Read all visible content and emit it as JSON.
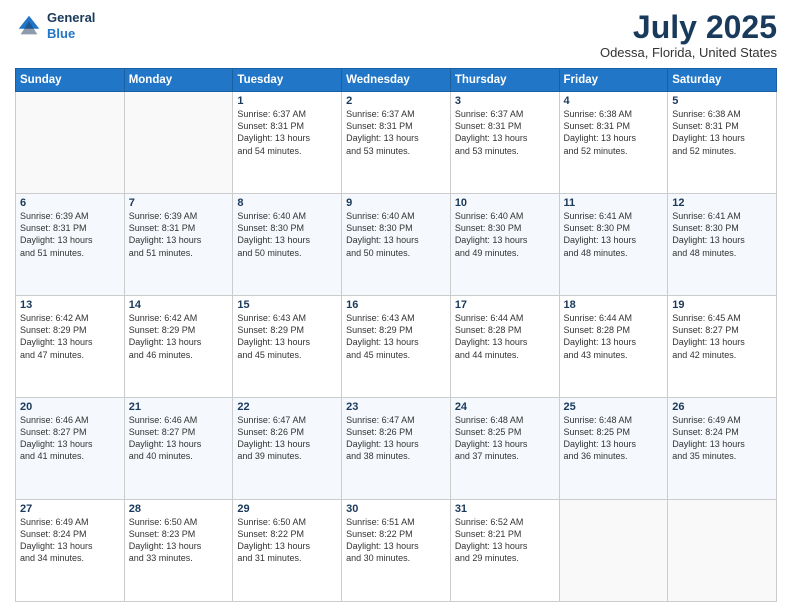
{
  "header": {
    "logo_line1": "General",
    "logo_line2": "Blue",
    "month": "July 2025",
    "location": "Odessa, Florida, United States"
  },
  "weekdays": [
    "Sunday",
    "Monday",
    "Tuesday",
    "Wednesday",
    "Thursday",
    "Friday",
    "Saturday"
  ],
  "weeks": [
    [
      {
        "day": "",
        "info": ""
      },
      {
        "day": "",
        "info": ""
      },
      {
        "day": "1",
        "info": "Sunrise: 6:37 AM\nSunset: 8:31 PM\nDaylight: 13 hours\nand 54 minutes."
      },
      {
        "day": "2",
        "info": "Sunrise: 6:37 AM\nSunset: 8:31 PM\nDaylight: 13 hours\nand 53 minutes."
      },
      {
        "day": "3",
        "info": "Sunrise: 6:37 AM\nSunset: 8:31 PM\nDaylight: 13 hours\nand 53 minutes."
      },
      {
        "day": "4",
        "info": "Sunrise: 6:38 AM\nSunset: 8:31 PM\nDaylight: 13 hours\nand 52 minutes."
      },
      {
        "day": "5",
        "info": "Sunrise: 6:38 AM\nSunset: 8:31 PM\nDaylight: 13 hours\nand 52 minutes."
      }
    ],
    [
      {
        "day": "6",
        "info": "Sunrise: 6:39 AM\nSunset: 8:31 PM\nDaylight: 13 hours\nand 51 minutes."
      },
      {
        "day": "7",
        "info": "Sunrise: 6:39 AM\nSunset: 8:31 PM\nDaylight: 13 hours\nand 51 minutes."
      },
      {
        "day": "8",
        "info": "Sunrise: 6:40 AM\nSunset: 8:30 PM\nDaylight: 13 hours\nand 50 minutes."
      },
      {
        "day": "9",
        "info": "Sunrise: 6:40 AM\nSunset: 8:30 PM\nDaylight: 13 hours\nand 50 minutes."
      },
      {
        "day": "10",
        "info": "Sunrise: 6:40 AM\nSunset: 8:30 PM\nDaylight: 13 hours\nand 49 minutes."
      },
      {
        "day": "11",
        "info": "Sunrise: 6:41 AM\nSunset: 8:30 PM\nDaylight: 13 hours\nand 48 minutes."
      },
      {
        "day": "12",
        "info": "Sunrise: 6:41 AM\nSunset: 8:30 PM\nDaylight: 13 hours\nand 48 minutes."
      }
    ],
    [
      {
        "day": "13",
        "info": "Sunrise: 6:42 AM\nSunset: 8:29 PM\nDaylight: 13 hours\nand 47 minutes."
      },
      {
        "day": "14",
        "info": "Sunrise: 6:42 AM\nSunset: 8:29 PM\nDaylight: 13 hours\nand 46 minutes."
      },
      {
        "day": "15",
        "info": "Sunrise: 6:43 AM\nSunset: 8:29 PM\nDaylight: 13 hours\nand 45 minutes."
      },
      {
        "day": "16",
        "info": "Sunrise: 6:43 AM\nSunset: 8:29 PM\nDaylight: 13 hours\nand 45 minutes."
      },
      {
        "day": "17",
        "info": "Sunrise: 6:44 AM\nSunset: 8:28 PM\nDaylight: 13 hours\nand 44 minutes."
      },
      {
        "day": "18",
        "info": "Sunrise: 6:44 AM\nSunset: 8:28 PM\nDaylight: 13 hours\nand 43 minutes."
      },
      {
        "day": "19",
        "info": "Sunrise: 6:45 AM\nSunset: 8:27 PM\nDaylight: 13 hours\nand 42 minutes."
      }
    ],
    [
      {
        "day": "20",
        "info": "Sunrise: 6:46 AM\nSunset: 8:27 PM\nDaylight: 13 hours\nand 41 minutes."
      },
      {
        "day": "21",
        "info": "Sunrise: 6:46 AM\nSunset: 8:27 PM\nDaylight: 13 hours\nand 40 minutes."
      },
      {
        "day": "22",
        "info": "Sunrise: 6:47 AM\nSunset: 8:26 PM\nDaylight: 13 hours\nand 39 minutes."
      },
      {
        "day": "23",
        "info": "Sunrise: 6:47 AM\nSunset: 8:26 PM\nDaylight: 13 hours\nand 38 minutes."
      },
      {
        "day": "24",
        "info": "Sunrise: 6:48 AM\nSunset: 8:25 PM\nDaylight: 13 hours\nand 37 minutes."
      },
      {
        "day": "25",
        "info": "Sunrise: 6:48 AM\nSunset: 8:25 PM\nDaylight: 13 hours\nand 36 minutes."
      },
      {
        "day": "26",
        "info": "Sunrise: 6:49 AM\nSunset: 8:24 PM\nDaylight: 13 hours\nand 35 minutes."
      }
    ],
    [
      {
        "day": "27",
        "info": "Sunrise: 6:49 AM\nSunset: 8:24 PM\nDaylight: 13 hours\nand 34 minutes."
      },
      {
        "day": "28",
        "info": "Sunrise: 6:50 AM\nSunset: 8:23 PM\nDaylight: 13 hours\nand 33 minutes."
      },
      {
        "day": "29",
        "info": "Sunrise: 6:50 AM\nSunset: 8:22 PM\nDaylight: 13 hours\nand 31 minutes."
      },
      {
        "day": "30",
        "info": "Sunrise: 6:51 AM\nSunset: 8:22 PM\nDaylight: 13 hours\nand 30 minutes."
      },
      {
        "day": "31",
        "info": "Sunrise: 6:52 AM\nSunset: 8:21 PM\nDaylight: 13 hours\nand 29 minutes."
      },
      {
        "day": "",
        "info": ""
      },
      {
        "day": "",
        "info": ""
      }
    ]
  ]
}
